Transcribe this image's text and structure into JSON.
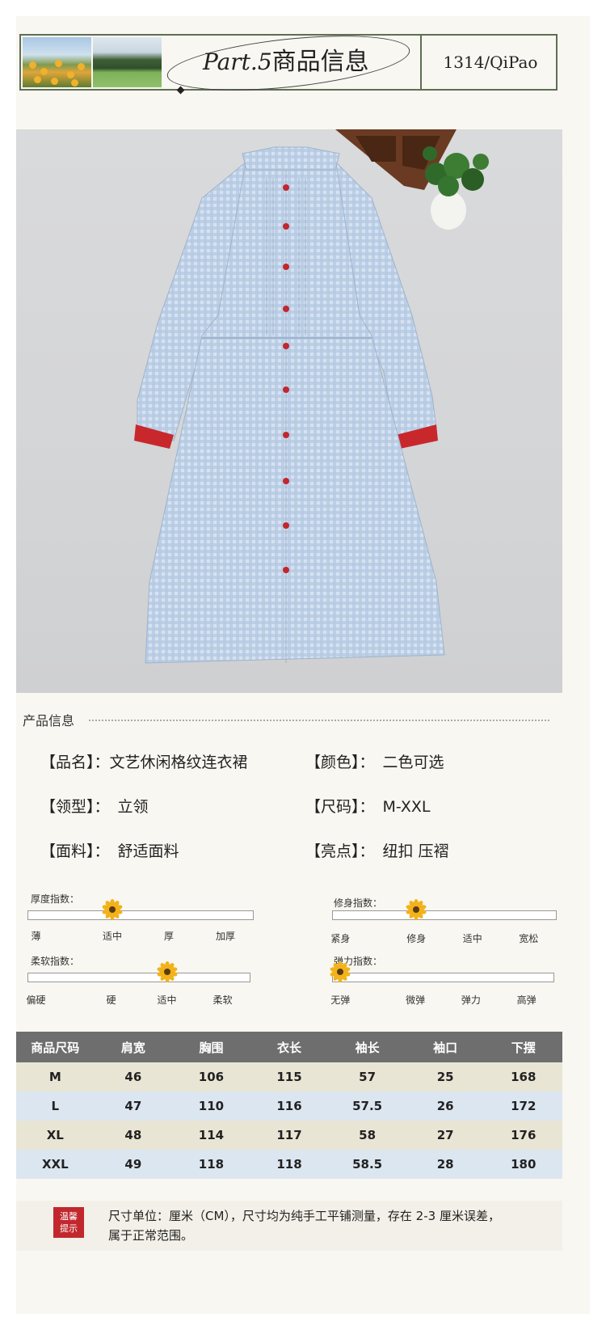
{
  "header": {
    "part_label": "Part.5",
    "title": "商品信息",
    "brand": "1314/QiPao"
  },
  "product_photo": {
    "button_color": "#c1272d",
    "fabric_color": "#b9cde6",
    "cuff_color": "#c8282c"
  },
  "info": {
    "section_title": "产品信息",
    "attributes": [
      {
        "label": "【品名】：",
        "value": "文艺休闲格纹连衣裙"
      },
      {
        "label": "【颜色】：",
        "value": "二色可选"
      },
      {
        "label": "【领型】：",
        "value": "立领"
      },
      {
        "label": "【尺码】：",
        "value": "M-XXL"
      },
      {
        "label": "【面料】：",
        "value": "舒适面料"
      },
      {
        "label": "【亮点】：",
        "value": "纽扣 压褶"
      }
    ]
  },
  "indices": [
    {
      "title": "厚度指数：",
      "ticks": [
        "薄",
        "适中",
        "厚",
        "加厚"
      ],
      "selected": 1
    },
    {
      "title": "修身指数：",
      "ticks": [
        "紧身",
        "修身",
        "适中",
        "宽松"
      ],
      "selected": 1
    },
    {
      "title": "柔软指数：",
      "ticks": [
        "偏硬",
        "硬",
        "适中",
        "柔软"
      ],
      "selected": 2
    },
    {
      "title": "弹力指数：",
      "ticks": [
        "无弹",
        "微弹",
        "弹力",
        "高弹"
      ],
      "selected": 0
    }
  ],
  "size_table": {
    "headers": [
      "商品尺码",
      "肩宽",
      "胸围",
      "衣长",
      "袖长",
      "袖口",
      "下摆"
    ],
    "rows": [
      [
        "M",
        "46",
        "106",
        "115",
        "57",
        "25",
        "168"
      ],
      [
        "L",
        "47",
        "110",
        "116",
        "57.5",
        "26",
        "172"
      ],
      [
        "XL",
        "48",
        "114",
        "117",
        "58",
        "27",
        "176"
      ],
      [
        "XXL",
        "49",
        "118",
        "118",
        "58.5",
        "28",
        "180"
      ]
    ]
  },
  "note": {
    "badge_line1": "温馨",
    "badge_line2": "提示",
    "text_line1": "尺寸单位：厘米（CM），尺寸均为纯手工平铺测量，存在 2-3 厘米误差，",
    "text_line2": "属于正常范围。"
  }
}
